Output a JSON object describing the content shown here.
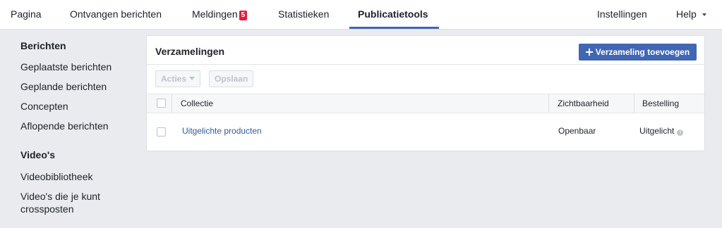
{
  "topnav": {
    "items": [
      {
        "label": "Pagina"
      },
      {
        "label": "Ontvangen berichten"
      },
      {
        "label": "Meldingen",
        "badge": "5"
      },
      {
        "label": "Statistieken"
      },
      {
        "label": "Publicatietools"
      }
    ],
    "active": "Publicatietools",
    "right": {
      "settings": "Instellingen",
      "help": "Help"
    }
  },
  "sidebar": {
    "sections": [
      {
        "heading": "Berichten",
        "items": [
          "Geplaatste berichten",
          "Geplande berichten",
          "Concepten",
          "Aflopende berichten"
        ]
      },
      {
        "heading": "Video's",
        "items": [
          "Videobibliotheek",
          "Video's die je kunt crossposten"
        ]
      }
    ]
  },
  "main": {
    "title": "Verzamelingen",
    "add_button": "Verzameling toevoegen",
    "actions_button": "Acties",
    "save_button": "Opslaan",
    "table": {
      "columns": [
        "Collectie",
        "Zichtbaarheid",
        "Bestelling"
      ],
      "rows": [
        {
          "collection": "Uitgelichte producten",
          "visibility": "Openbaar",
          "order": "Uitgelicht"
        }
      ]
    }
  },
  "colors": {
    "accent": "#4267b2",
    "link": "#365899",
    "badge": "#e41e3f",
    "background": "#e9ebee"
  },
  "icons": [
    "plus-icon",
    "caret-down-icon",
    "info-icon",
    "checkbox"
  ]
}
